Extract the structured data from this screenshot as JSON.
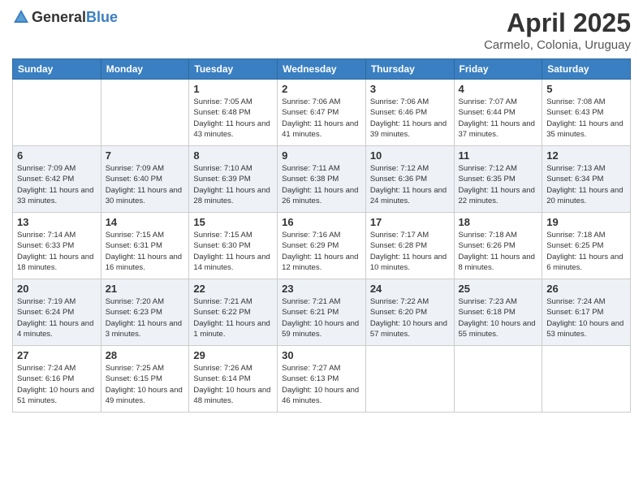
{
  "logo": {
    "general": "General",
    "blue": "Blue"
  },
  "header": {
    "month": "April 2025",
    "location": "Carmelo, Colonia, Uruguay"
  },
  "weekdays": [
    "Sunday",
    "Monday",
    "Tuesday",
    "Wednesday",
    "Thursday",
    "Friday",
    "Saturday"
  ],
  "weeks": [
    [
      {
        "day": "",
        "info": ""
      },
      {
        "day": "",
        "info": ""
      },
      {
        "day": "1",
        "info": "Sunrise: 7:05 AM\nSunset: 6:48 PM\nDaylight: 11 hours and 43 minutes."
      },
      {
        "day": "2",
        "info": "Sunrise: 7:06 AM\nSunset: 6:47 PM\nDaylight: 11 hours and 41 minutes."
      },
      {
        "day": "3",
        "info": "Sunrise: 7:06 AM\nSunset: 6:46 PM\nDaylight: 11 hours and 39 minutes."
      },
      {
        "day": "4",
        "info": "Sunrise: 7:07 AM\nSunset: 6:44 PM\nDaylight: 11 hours and 37 minutes."
      },
      {
        "day": "5",
        "info": "Sunrise: 7:08 AM\nSunset: 6:43 PM\nDaylight: 11 hours and 35 minutes."
      }
    ],
    [
      {
        "day": "6",
        "info": "Sunrise: 7:09 AM\nSunset: 6:42 PM\nDaylight: 11 hours and 33 minutes."
      },
      {
        "day": "7",
        "info": "Sunrise: 7:09 AM\nSunset: 6:40 PM\nDaylight: 11 hours and 30 minutes."
      },
      {
        "day": "8",
        "info": "Sunrise: 7:10 AM\nSunset: 6:39 PM\nDaylight: 11 hours and 28 minutes."
      },
      {
        "day": "9",
        "info": "Sunrise: 7:11 AM\nSunset: 6:38 PM\nDaylight: 11 hours and 26 minutes."
      },
      {
        "day": "10",
        "info": "Sunrise: 7:12 AM\nSunset: 6:36 PM\nDaylight: 11 hours and 24 minutes."
      },
      {
        "day": "11",
        "info": "Sunrise: 7:12 AM\nSunset: 6:35 PM\nDaylight: 11 hours and 22 minutes."
      },
      {
        "day": "12",
        "info": "Sunrise: 7:13 AM\nSunset: 6:34 PM\nDaylight: 11 hours and 20 minutes."
      }
    ],
    [
      {
        "day": "13",
        "info": "Sunrise: 7:14 AM\nSunset: 6:33 PM\nDaylight: 11 hours and 18 minutes."
      },
      {
        "day": "14",
        "info": "Sunrise: 7:15 AM\nSunset: 6:31 PM\nDaylight: 11 hours and 16 minutes."
      },
      {
        "day": "15",
        "info": "Sunrise: 7:15 AM\nSunset: 6:30 PM\nDaylight: 11 hours and 14 minutes."
      },
      {
        "day": "16",
        "info": "Sunrise: 7:16 AM\nSunset: 6:29 PM\nDaylight: 11 hours and 12 minutes."
      },
      {
        "day": "17",
        "info": "Sunrise: 7:17 AM\nSunset: 6:28 PM\nDaylight: 11 hours and 10 minutes."
      },
      {
        "day": "18",
        "info": "Sunrise: 7:18 AM\nSunset: 6:26 PM\nDaylight: 11 hours and 8 minutes."
      },
      {
        "day": "19",
        "info": "Sunrise: 7:18 AM\nSunset: 6:25 PM\nDaylight: 11 hours and 6 minutes."
      }
    ],
    [
      {
        "day": "20",
        "info": "Sunrise: 7:19 AM\nSunset: 6:24 PM\nDaylight: 11 hours and 4 minutes."
      },
      {
        "day": "21",
        "info": "Sunrise: 7:20 AM\nSunset: 6:23 PM\nDaylight: 11 hours and 3 minutes."
      },
      {
        "day": "22",
        "info": "Sunrise: 7:21 AM\nSunset: 6:22 PM\nDaylight: 11 hours and 1 minute."
      },
      {
        "day": "23",
        "info": "Sunrise: 7:21 AM\nSunset: 6:21 PM\nDaylight: 10 hours and 59 minutes."
      },
      {
        "day": "24",
        "info": "Sunrise: 7:22 AM\nSunset: 6:20 PM\nDaylight: 10 hours and 57 minutes."
      },
      {
        "day": "25",
        "info": "Sunrise: 7:23 AM\nSunset: 6:18 PM\nDaylight: 10 hours and 55 minutes."
      },
      {
        "day": "26",
        "info": "Sunrise: 7:24 AM\nSunset: 6:17 PM\nDaylight: 10 hours and 53 minutes."
      }
    ],
    [
      {
        "day": "27",
        "info": "Sunrise: 7:24 AM\nSunset: 6:16 PM\nDaylight: 10 hours and 51 minutes."
      },
      {
        "day": "28",
        "info": "Sunrise: 7:25 AM\nSunset: 6:15 PM\nDaylight: 10 hours and 49 minutes."
      },
      {
        "day": "29",
        "info": "Sunrise: 7:26 AM\nSunset: 6:14 PM\nDaylight: 10 hours and 48 minutes."
      },
      {
        "day": "30",
        "info": "Sunrise: 7:27 AM\nSunset: 6:13 PM\nDaylight: 10 hours and 46 minutes."
      },
      {
        "day": "",
        "info": ""
      },
      {
        "day": "",
        "info": ""
      },
      {
        "day": "",
        "info": ""
      }
    ]
  ]
}
